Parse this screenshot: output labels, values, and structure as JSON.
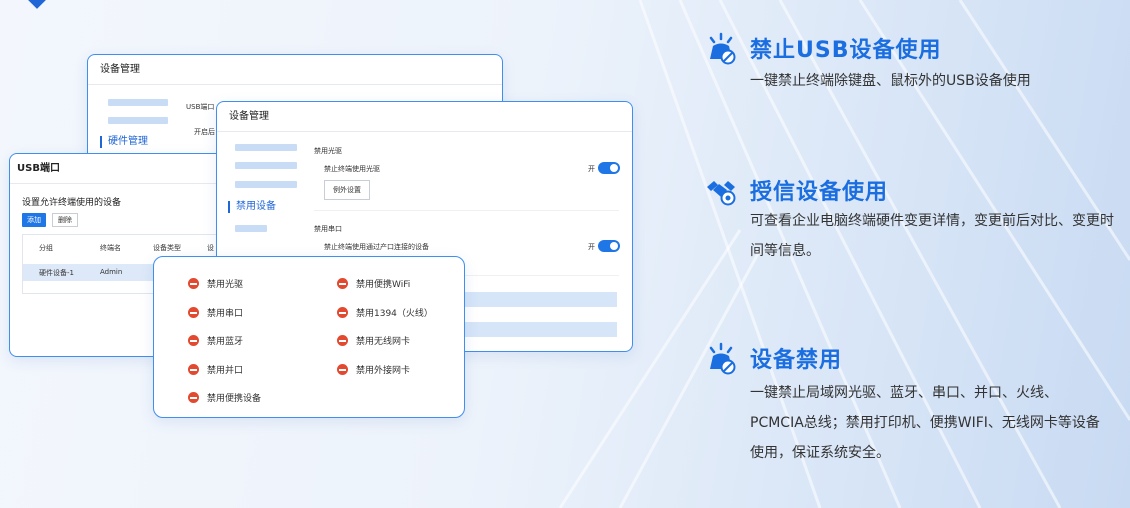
{
  "window_back": {
    "title": "设备管理",
    "nav_selected": "硬件管理",
    "section_label": "USB端口",
    "row_label": "开启后"
  },
  "window_usb": {
    "title": "USB端口",
    "subtitle": "设置允许终端使用的设备",
    "add_button": "添加",
    "delete_button": "删除",
    "columns": [
      "分组",
      "终端名",
      "设备类型",
      "设"
    ],
    "rows": [
      {
        "group": "硬件设备-1",
        "terminal": "Admin"
      }
    ]
  },
  "window_front": {
    "title": "设备管理",
    "nav_selected": "禁用设备",
    "section1": "禁用光驱",
    "section1_item": "禁止终端使用光驱",
    "section1_toggle_label": "开",
    "exception_button": "例外设置",
    "section2": "禁用串口",
    "section2_item": "禁止终端使用通过产口连接的设备",
    "section2_toggle_label": "开"
  },
  "popup": {
    "items_left": [
      "禁用光驱",
      "禁用串口",
      "禁用蓝牙",
      "禁用并口",
      "禁用便携设备"
    ],
    "items_right": [
      "禁用便携WiFi",
      "禁用1394（火线）",
      "禁用无线网卡",
      "禁用外接网卡"
    ]
  },
  "features": [
    {
      "title": "禁止USB设备使用",
      "desc": "一键禁止终端除键盘、鼠标外的USB设备使用",
      "icon": "usb-block-icon"
    },
    {
      "title": "授信设备使用",
      "desc": "可查看企业电脑终端硬件变更详情，变更前后对比、变更时间等信息。",
      "icon": "trusted-device-icon"
    },
    {
      "title": "设备禁用",
      "desc": "一键禁止局域网光驱、蓝牙、串口、并口、火线、PCMCIA总线；禁用打印机、便携WIFI、无线网卡等设备使用，保证系统安全。",
      "icon": "device-disable-icon"
    }
  ],
  "colors": {
    "accent": "#1b6ee0",
    "border": "#3f8ef0",
    "stop": "#e2492f"
  }
}
